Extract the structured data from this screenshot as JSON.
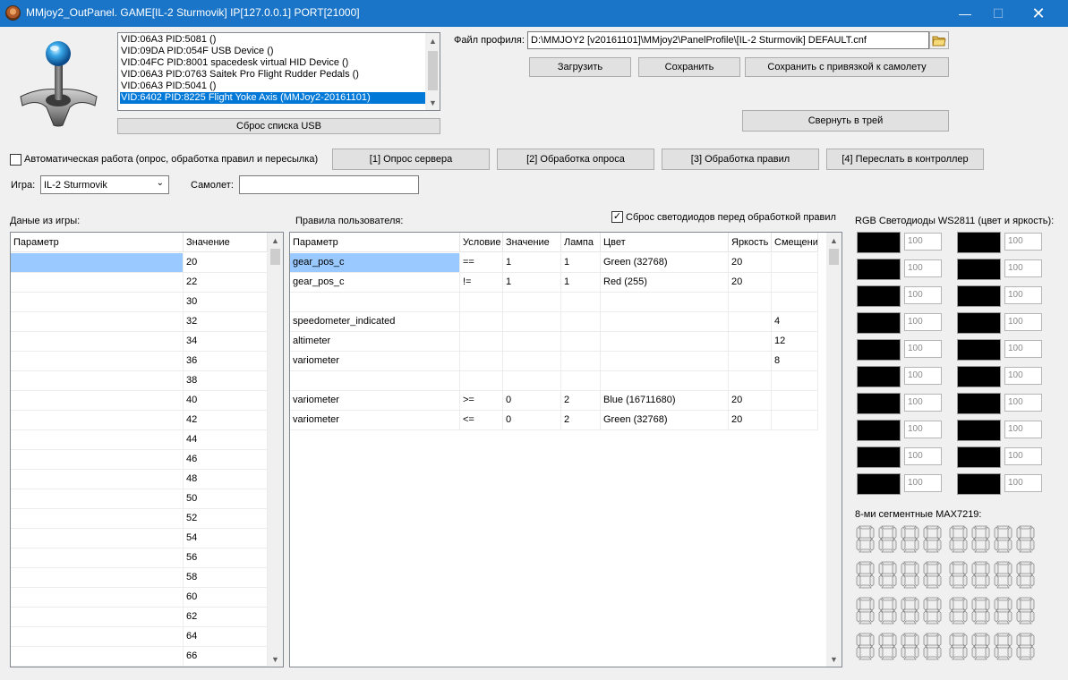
{
  "window": {
    "title": "MMjoy2_OutPanel. GAME[IL-2 Sturmovik] IP[127.0.0.1] PORT[21000]",
    "min_glyph": "—",
    "max_glyph": "☐",
    "close_glyph": "✕"
  },
  "usb": {
    "devices": [
      "VID:06A3 PID:5081  ()",
      "VID:09DA PID:054F USB Device ()",
      "VID:04FC PID:8001 spacedesk virtual HID Device ()",
      "VID:06A3 PID:0763 Saitek Pro Flight Rudder Pedals ()",
      "VID:06A3 PID:5041  ()",
      "VID:6402 PID:8225 Flight Yoke Axis (MMJoy2-20161101)"
    ],
    "selected_index": 5,
    "reset_button": "Сброс списка USB"
  },
  "profile": {
    "label": "Файл профиля:",
    "path": "D:\\MMJOY2 [v20161101]\\MMjoy2\\PanelProfile\\[IL-2 Sturmovik] DEFAULT.cnf",
    "load_button": "Загрузить",
    "save_button": "Сохранить",
    "save_bind_button": "Сохранить с привязкой к самолету",
    "tray_button": "Свернуть в трей"
  },
  "controls": {
    "auto_label": "Автоматическая работа (опрос, обработка правил и пересылка)",
    "auto_checked": false,
    "step1": "[1] Опрос сервера",
    "step2": "[2] Обработка опроса",
    "step3": "[3] Обработка правил",
    "step4": "[4] Переслать в контроллер",
    "game_label": "Игра:",
    "game_value": "IL-2 Sturmovik",
    "plane_label": "Самолет:",
    "plane_value": ""
  },
  "game_data": {
    "title": "Даные из игры:",
    "col_param": "Параметр",
    "col_value": "Значение",
    "rows": [
      {
        "param": "",
        "value": "20"
      },
      {
        "param": "",
        "value": "22"
      },
      {
        "param": "",
        "value": "30"
      },
      {
        "param": "",
        "value": "32"
      },
      {
        "param": "",
        "value": "34"
      },
      {
        "param": "",
        "value": "36"
      },
      {
        "param": "",
        "value": "38"
      },
      {
        "param": "",
        "value": "40"
      },
      {
        "param": "",
        "value": "42"
      },
      {
        "param": "",
        "value": "44"
      },
      {
        "param": "",
        "value": "46"
      },
      {
        "param": "",
        "value": "48"
      },
      {
        "param": "",
        "value": "50"
      },
      {
        "param": "",
        "value": "52"
      },
      {
        "param": "",
        "value": "54"
      },
      {
        "param": "",
        "value": "56"
      },
      {
        "param": "",
        "value": "58"
      },
      {
        "param": "",
        "value": "60"
      },
      {
        "param": "",
        "value": "62"
      },
      {
        "param": "",
        "value": "64"
      },
      {
        "param": "",
        "value": "66"
      }
    ]
  },
  "rules": {
    "title": "Правила пользователя:",
    "reset_led_label": "Сброс светодиодов перед обработкой правил",
    "reset_led_checked": true,
    "columns": [
      "Параметр",
      "Условие",
      "Значение",
      "Лампа",
      "Цвет",
      "Яркость",
      "Смещение"
    ],
    "rows": [
      [
        "gear_pos_c",
        "==",
        "1",
        "1",
        "Green (32768)",
        "20",
        ""
      ],
      [
        "gear_pos_c",
        "!=",
        "1",
        "1",
        "Red (255)",
        "20",
        ""
      ],
      [
        "",
        "",
        "",
        "",
        "",
        "",
        ""
      ],
      [
        "speedometer_indicated",
        "",
        "",
        "",
        "",
        "",
        "4"
      ],
      [
        "altimeter",
        "",
        "",
        "",
        "",
        "",
        "12"
      ],
      [
        "variometer",
        "",
        "",
        "",
        "",
        "",
        "8"
      ],
      [
        "",
        "",
        "",
        "",
        "",
        "",
        ""
      ],
      [
        "variometer",
        ">=",
        "0",
        "2",
        "Blue (16711680)",
        "20",
        ""
      ],
      [
        "variometer",
        "<=",
        "0",
        "2",
        "Green (32768)",
        "20",
        ""
      ]
    ]
  },
  "leds": {
    "title": "RGB Светодиоды WS2811 (цвет и яркость):",
    "values": [
      "100",
      "100",
      "100",
      "100",
      "100",
      "100",
      "100",
      "100",
      "100",
      "100",
      "100",
      "100",
      "100",
      "100",
      "100",
      "100",
      "100",
      "100",
      "100",
      "100"
    ]
  },
  "max7219": {
    "title": "8-ми сегментные MAX7219:"
  }
}
